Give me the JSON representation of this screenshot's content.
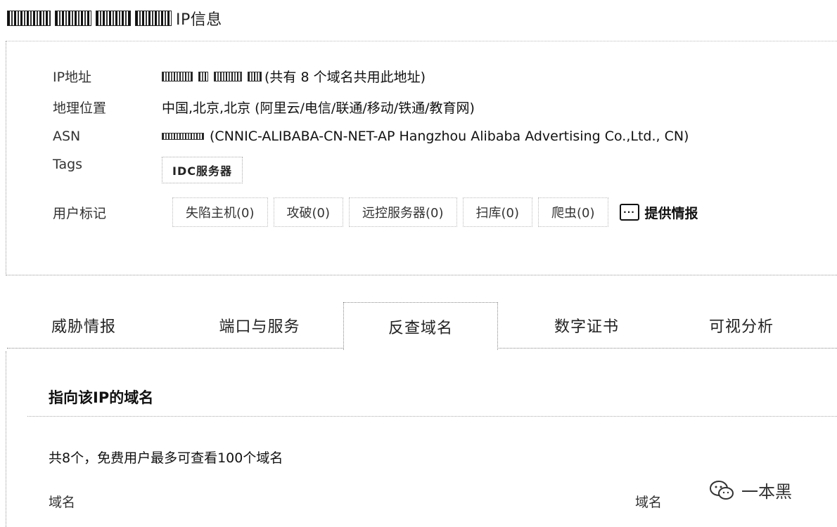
{
  "header": {
    "title": "IP信息"
  },
  "info": {
    "ip": {
      "label": "IP地址",
      "note": "(共有 8 个域名共用此地址)"
    },
    "geo": {
      "label": "地理位置",
      "value": "中国,北京,北京 (阿里云/电信/联通/移动/铁通/教育网)"
    },
    "asn": {
      "label": "ASN",
      "value": "(CNNIC-ALIBABA-CN-NET-AP Hangzhou Alibaba Advertising Co.,Ltd., CN)"
    },
    "tags": {
      "label": "Tags",
      "value": "IDC服务器"
    },
    "user_marks": {
      "label": "用户标记",
      "items": [
        "失陷主机(0)",
        "攻破(0)",
        "远控服务器(0)",
        "扫库(0)",
        "爬虫(0)"
      ],
      "report_label": "提供情报"
    }
  },
  "tabs": [
    {
      "label": "威胁情报",
      "active": false
    },
    {
      "label": "端口与服务",
      "active": false
    },
    {
      "label": "反查域名",
      "active": true
    },
    {
      "label": "数字证书",
      "active": false
    },
    {
      "label": "可视分析",
      "active": false
    }
  ],
  "domains": {
    "section_title": "指向该IP的域名",
    "count_line": "共8个，免费用户最多可查看100个域名",
    "col_left": "域名",
    "col_right": "域名"
  },
  "watermark": {
    "text": "一本黑"
  },
  "icons": {
    "report": "chat-bubble-icon",
    "watermark": "wechat-icon"
  }
}
